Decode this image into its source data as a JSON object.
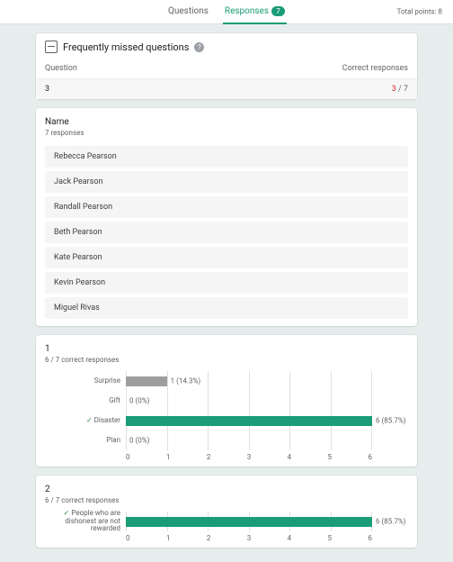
{
  "tabs": {
    "questions": "Questions",
    "responses": "Responses",
    "responses_count": "7"
  },
  "total_points_label": "Total points: 8",
  "fmq": {
    "title": "Frequently missed questions",
    "col_question": "Question",
    "col_correct": "Correct responses",
    "rows": [
      {
        "question": "3",
        "correct": "3",
        "total": "/ 7"
      }
    ]
  },
  "name_block": {
    "title": "Name",
    "subtitle": "7 responses",
    "names": [
      "Rebecca Pearson",
      "Jack Pearson",
      "Randall Pearson",
      "Beth Pearson",
      "Kate Pearson",
      "Kevin Pearson",
      "Miguel Rivas"
    ]
  },
  "chart_data": [
    {
      "type": "bar",
      "title": "1",
      "subtitle": "6 / 7 correct responses",
      "xlabel": "",
      "ylabel": "",
      "xticks": [
        "0",
        "1",
        "2",
        "3",
        "4",
        "5",
        "6"
      ],
      "xmax": 6,
      "series": [
        {
          "label": "Surprise",
          "count": 1,
          "pct": "14.3%",
          "correct": false,
          "text": "1 (14.3%)"
        },
        {
          "label": "Gift",
          "count": 0,
          "pct": "0%",
          "correct": false,
          "text": "0 (0%)"
        },
        {
          "label": "Disaster",
          "count": 6,
          "pct": "85.7%",
          "correct": true,
          "text": "6 (85.7%)"
        },
        {
          "label": "Plan",
          "count": 0,
          "pct": "0%",
          "correct": false,
          "text": "0 (0%)"
        }
      ]
    },
    {
      "type": "bar",
      "title": "2",
      "subtitle": "6 / 7 correct responses",
      "xlabel": "",
      "ylabel": "",
      "xticks": [
        "0",
        "1",
        "2",
        "3",
        "4",
        "5",
        "6"
      ],
      "xmax": 6,
      "series": [
        {
          "label": "People who are dishonest are not rewarded",
          "count": 6,
          "pct": "85.7%",
          "correct": true,
          "text": "6 (85.7%)"
        }
      ]
    }
  ]
}
